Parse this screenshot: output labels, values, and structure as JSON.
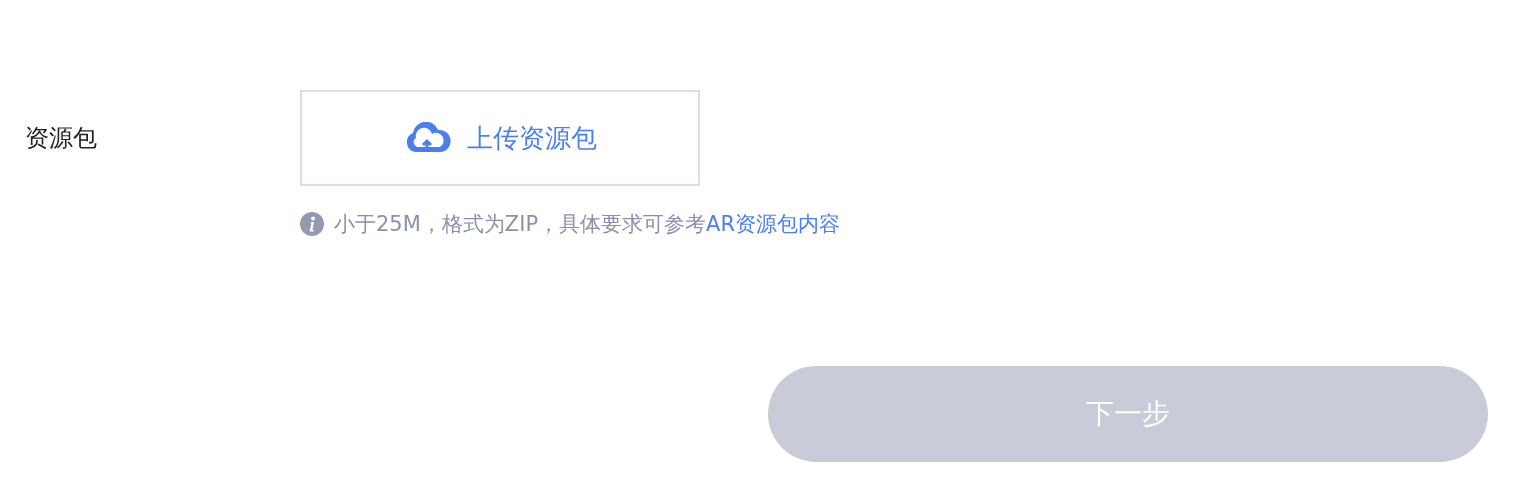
{
  "form": {
    "label": "资源包",
    "upload_button": "上传资源包",
    "hint": {
      "text": "小于25M，格式为ZIP，具体要求可参考",
      "link": "AR资源包内容"
    }
  },
  "next_button": {
    "label": "下一步",
    "disabled": true
  }
}
